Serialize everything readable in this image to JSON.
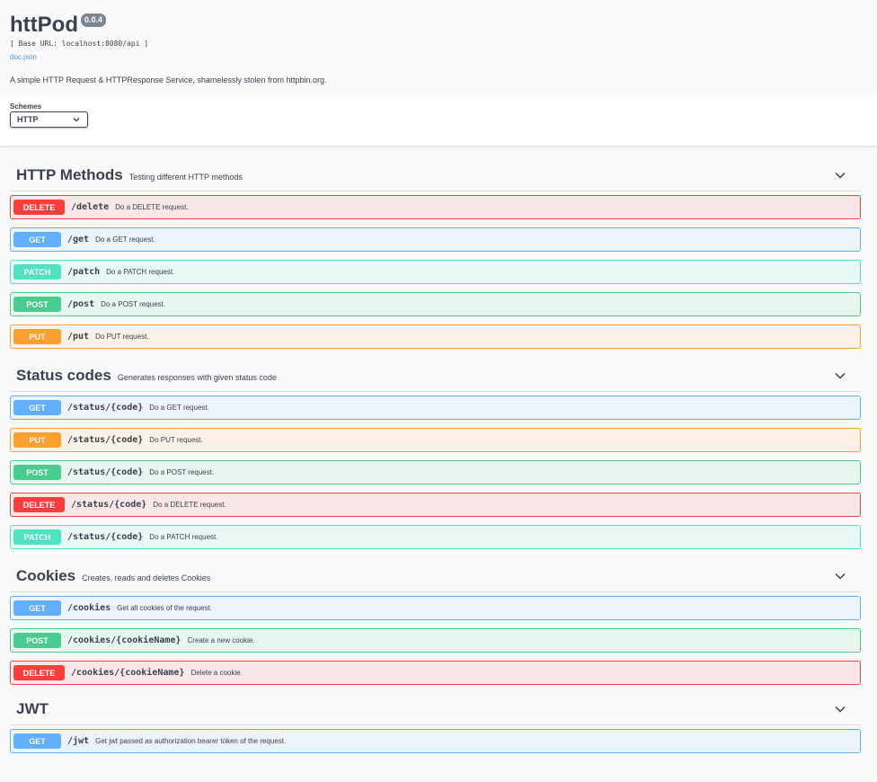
{
  "info": {
    "title": "httPod",
    "version": "0.0.4",
    "base_url": "[ Base URL: localhost:8080/api ]",
    "doc_link": "doc.json",
    "description": "A simple HTTP Request & HTTPResponse Service, shamelessly stolen from httpbin.org."
  },
  "schemes": {
    "label": "Schemes",
    "selected": "HTTP"
  },
  "tags": [
    {
      "name": "HTTP Methods",
      "description": "Testing different HTTP methods",
      "operations": [
        {
          "method": "DELETE",
          "path": "/delete",
          "summary": "Do a DELETE request."
        },
        {
          "method": "GET",
          "path": "/get",
          "summary": "Do a GET request."
        },
        {
          "method": "PATCH",
          "path": "/patch",
          "summary": "Do a PATCH request."
        },
        {
          "method": "POST",
          "path": "/post",
          "summary": "Do a POST request."
        },
        {
          "method": "PUT",
          "path": "/put",
          "summary": "Do PUT request."
        }
      ]
    },
    {
      "name": "Status codes",
      "description": "Generates responses with given status code",
      "operations": [
        {
          "method": "GET",
          "path": "/status/{code}",
          "summary": "Do a GET request."
        },
        {
          "method": "PUT",
          "path": "/status/{code}",
          "summary": "Do PUT request."
        },
        {
          "method": "POST",
          "path": "/status/{code}",
          "summary": "Do a POST request."
        },
        {
          "method": "DELETE",
          "path": "/status/{code}",
          "summary": "Do a DELETE request."
        },
        {
          "method": "PATCH",
          "path": "/status/{code}",
          "summary": "Do a PATCH request."
        }
      ]
    },
    {
      "name": "Cookies",
      "description": "Creates, reads and deletes Cookies",
      "operations": [
        {
          "method": "GET",
          "path": "/cookies",
          "summary": "Get all cookies of the request."
        },
        {
          "method": "POST",
          "path": "/cookies/{cookieName}",
          "summary": "Create a new cookie."
        },
        {
          "method": "DELETE",
          "path": "/cookies/{cookieName}",
          "summary": "Delete a cookie."
        }
      ]
    },
    {
      "name": "JWT",
      "description": "",
      "operations": [
        {
          "method": "GET",
          "path": "/jwt",
          "summary": "Get jwt passed as authorization bearer token of the request."
        }
      ]
    }
  ],
  "colors": {
    "get": "#61affe",
    "post": "#49cc90",
    "put": "#fca130",
    "delete": "#f93e3e",
    "patch": "#50e3c2"
  }
}
